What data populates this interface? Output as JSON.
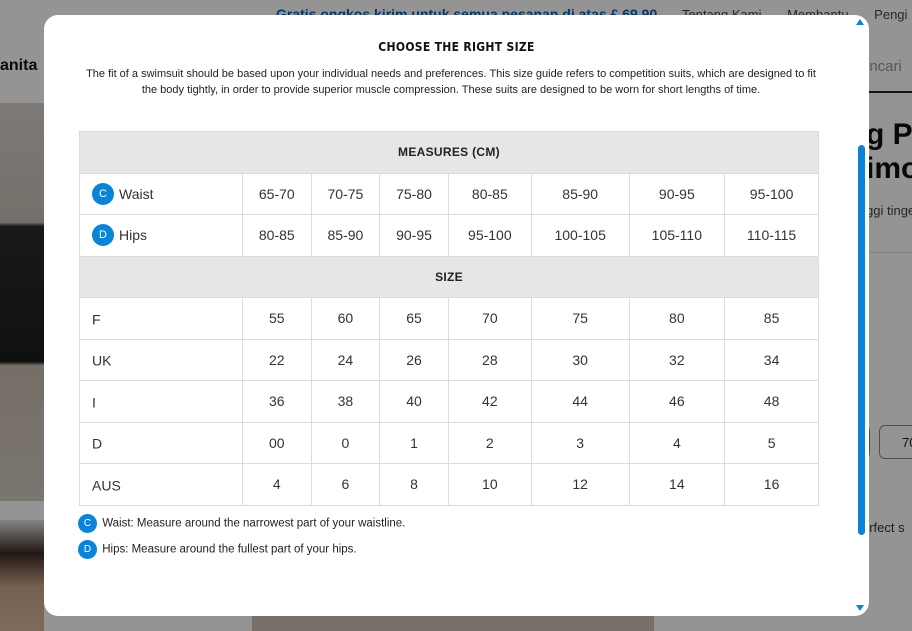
{
  "background": {
    "promo_text": "Gratis ongkos kirim untuk semua pesanan di atas £ 69.90",
    "top_nav": [
      "Tentang Kami",
      "Membantu",
      "Pengi"
    ],
    "category_label": "anita",
    "search_placeholder": "encari",
    "product_title_line1": "g P",
    "product_title_line2": "imo",
    "product_subtitle": "ggi tinge",
    "size_button_label": "70",
    "perfect_text": "erfect s"
  },
  "modal": {
    "title": "CHOOSE THE RIGHT SIZE",
    "intro": "The fit of a swimsuit should be based upon your individual needs and preferences. This size guide refers to competition suits, which are designed to fit the body tightly, in order to provide superior muscle compression. These suits are designed to be worn for short lengths of time.",
    "measures_heading": "MEASURES (CM)",
    "size_heading": "SIZE",
    "measures": [
      {
        "badge": "C",
        "label": "Waist",
        "values": [
          "65-70",
          "70-75",
          "75-80",
          "80-85",
          "85-90",
          "90-95",
          "95-100"
        ]
      },
      {
        "badge": "D",
        "label": "Hips",
        "values": [
          "80-85",
          "85-90",
          "90-95",
          "95-100",
          "100-105",
          "105-110",
          "110-115"
        ]
      }
    ],
    "sizes": [
      {
        "label": "F",
        "values": [
          "55",
          "60",
          "65",
          "70",
          "75",
          "80",
          "85"
        ]
      },
      {
        "label": "UK",
        "values": [
          "22",
          "24",
          "26",
          "28",
          "30",
          "32",
          "34"
        ]
      },
      {
        "label": "I",
        "values": [
          "36",
          "38",
          "40",
          "42",
          "44",
          "46",
          "48"
        ]
      },
      {
        "label": "D",
        "values": [
          "00",
          "0",
          "1",
          "2",
          "3",
          "4",
          "5"
        ]
      },
      {
        "label": "AUS",
        "values": [
          "4",
          "6",
          "8",
          "10",
          "12",
          "14",
          "16"
        ]
      }
    ],
    "notes": [
      {
        "badge": "C",
        "text": "Waist: Measure around the narrowest part of your waistline."
      },
      {
        "badge": "D",
        "text": "Hips: Measure around the fullest part of your hips."
      }
    ]
  },
  "colors": {
    "accent": "#0b84d8",
    "promo": "#0a5fb4",
    "header_bg": "#e6e6e6"
  },
  "icons": {
    "scroll_up": "triangle-up-icon",
    "scroll_down": "triangle-down-icon"
  }
}
